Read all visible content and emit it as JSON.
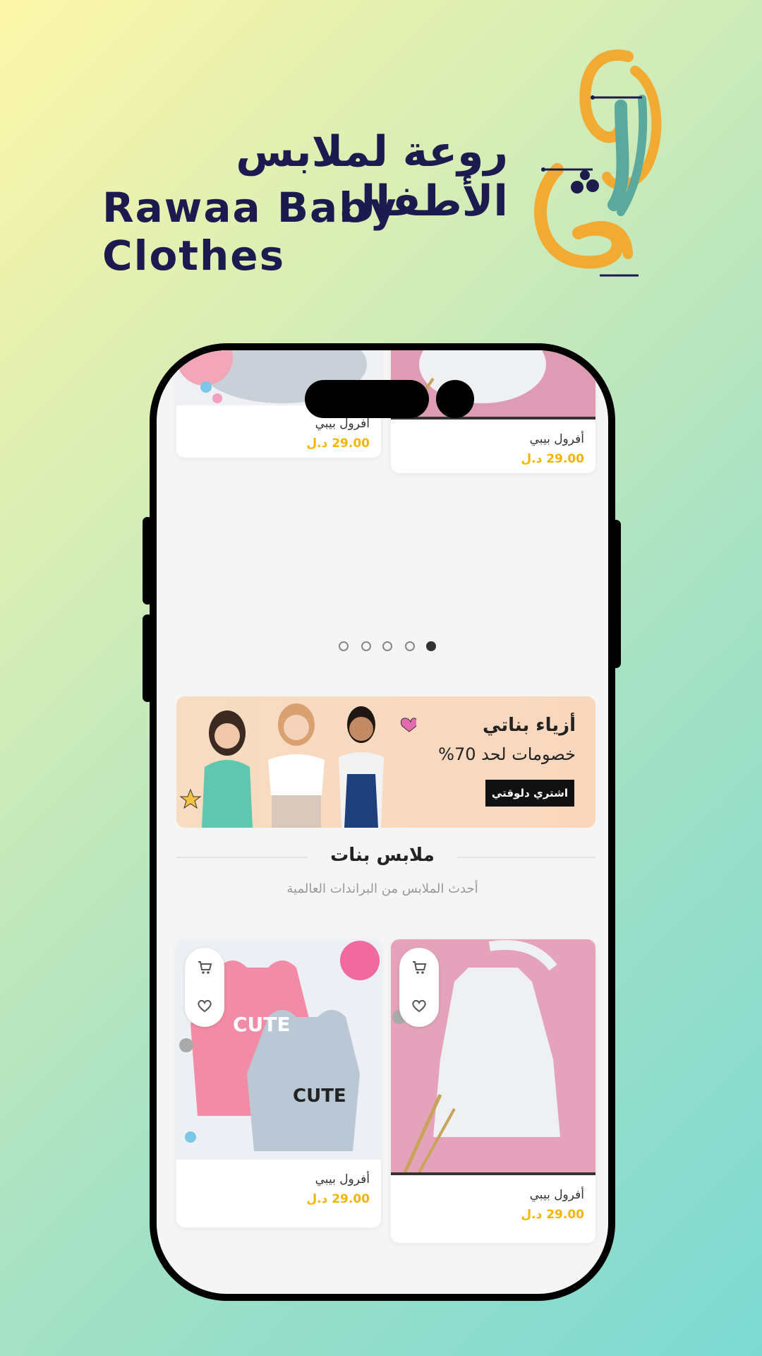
{
  "brand": {
    "name_ar": "روعة لملابس الأطفال",
    "name_en": "Rawaa Baby Clothes"
  },
  "carousel": {
    "dots_count": 5,
    "active_index": 4,
    "products": [
      {
        "name": "أفرول بيبي",
        "price": "29.00 د.ل"
      },
      {
        "name": "أفرول بيبي",
        "price": "29.00 د.ل"
      }
    ]
  },
  "banner": {
    "title": "أزياء بناتي",
    "subtitle": "خصومات لحد 70%",
    "button": "اشتري دلوقتي"
  },
  "section": {
    "title": "ملابس بنات",
    "subtitle": "أحدث الملابس من البراندات العالمية",
    "products": [
      {
        "name": "أفرول بيبي",
        "price": "29.00 د.ل"
      },
      {
        "name": "أفرول بيبي",
        "price": "29.00 د.ل"
      }
    ]
  },
  "colors": {
    "brand_navy": "#1d1a4f",
    "brand_orange": "#f2ab32",
    "brand_teal": "#5aa99c",
    "price": "#f4b400"
  },
  "icons": {
    "cart": "cart-icon",
    "wishlist": "heart-icon"
  }
}
